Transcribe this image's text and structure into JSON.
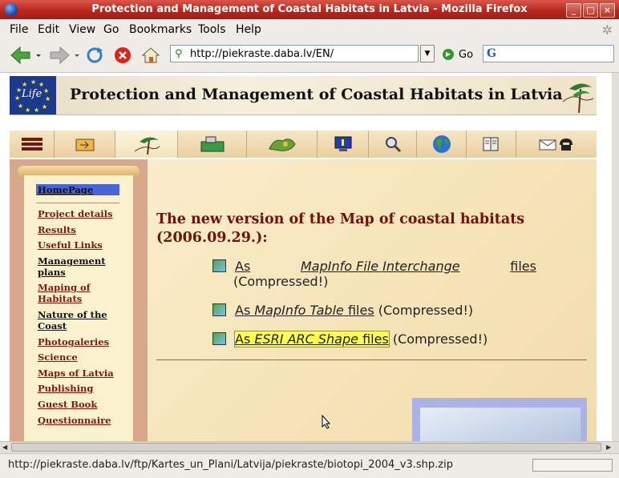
{
  "window": {
    "title": "Protection and Management of Coastal Habitats in Latvia - Mozilla Firefox",
    "controls": [
      "_",
      "□",
      "×"
    ]
  },
  "menu": [
    "File",
    "Edit",
    "View",
    "Go",
    "Bookmarks",
    "Tools",
    "Help"
  ],
  "nav": {
    "url": "http://piekraste.daba.lv/EN/",
    "go_label": "Go",
    "search_placeholder": ""
  },
  "page": {
    "banner_title": "Protection and Management of Coastal Habitats in Latvia",
    "logo_text": "Life",
    "sidebar": {
      "home": "HomePage",
      "items": [
        {
          "label": "Project details"
        },
        {
          "label": "Results"
        },
        {
          "label": "Useful Links"
        },
        {
          "label": "Management plans"
        },
        {
          "label": "Maping of Habitats"
        },
        {
          "label": "Nature of the Coast"
        },
        {
          "label": "Photogaleries"
        },
        {
          "label": "Science"
        },
        {
          "label": "Maps of Latvia"
        },
        {
          "label": "Publishing"
        },
        {
          "label": "Guest Book"
        },
        {
          "label": "Questionnaire"
        }
      ]
    },
    "heading": "The new version of the Map of coastal habitats (2006.09.29.):",
    "downloads": [
      {
        "prefix": "As ",
        "italic": "MapInfo File Interchange",
        "suffix": " files",
        "note": "(Compressed!)"
      },
      {
        "prefix": "As ",
        "italic": "MapInfo Table",
        "suffix": " files",
        "note": "(Compressed!)"
      },
      {
        "prefix": "As ",
        "italic": "ESRI ARC Shape",
        "suffix": " files",
        "note": "(Compressed!)"
      }
    ]
  },
  "status": {
    "text": "http://piekraste.daba.lv/ftp/Kartes_un_Plani/Latvija/piekraste/biotopi_2004_v3.shp.zip"
  },
  "colors": {
    "titlebar": "#b8271d",
    "heading": "#6e1308",
    "sidebar_link": "#7a1a10",
    "highlight": "#ffff55"
  }
}
